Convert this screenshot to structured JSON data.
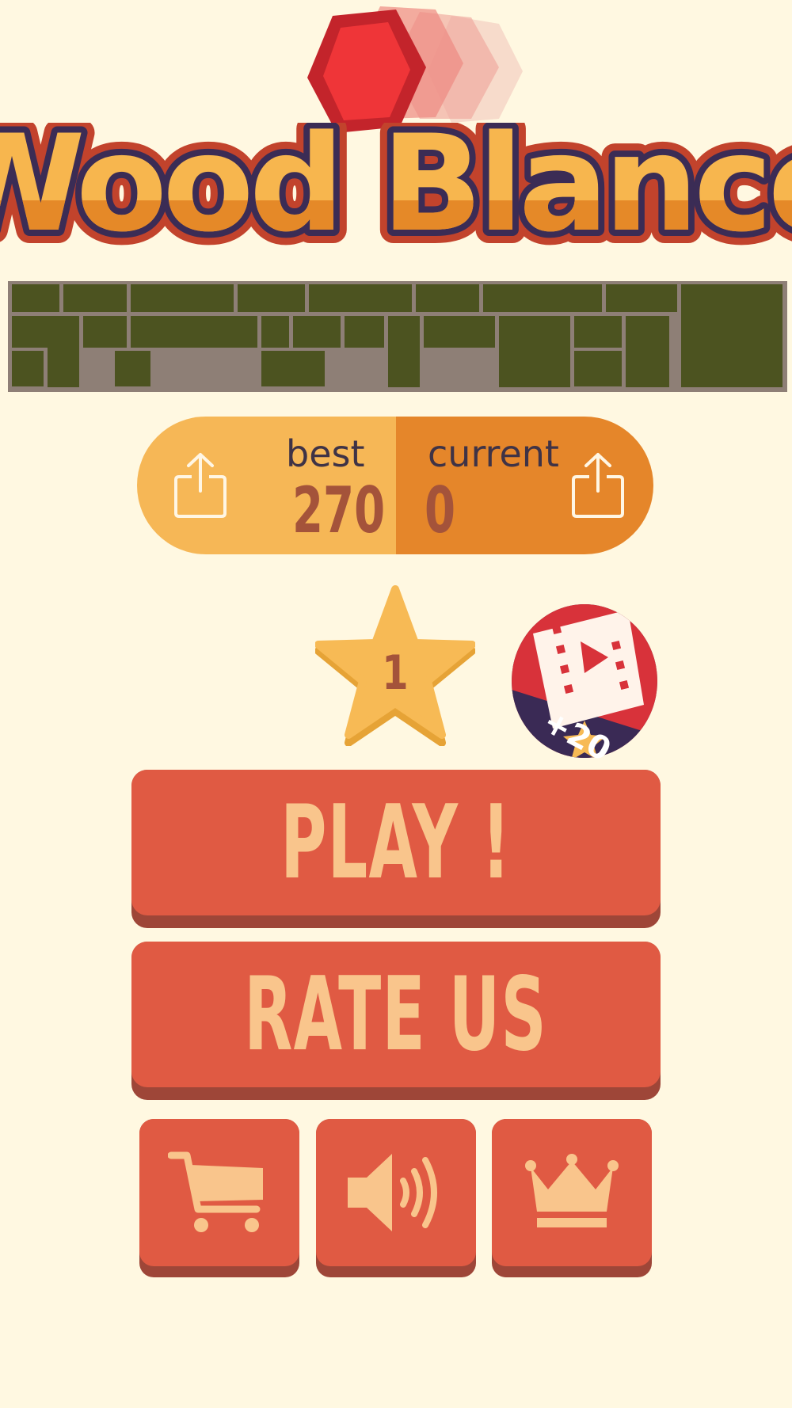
{
  "logo": {
    "title": "Wood Blance"
  },
  "scores": {
    "best_label": "best",
    "best_value": "270",
    "current_label": "current",
    "current_value": "0"
  },
  "stars": {
    "count": "1"
  },
  "video_reward": {
    "amount": "+20"
  },
  "buttons": {
    "play": "PLAY !",
    "rate": "RATE US"
  },
  "icons": {
    "share": "share-icon",
    "shop": "cart-icon",
    "sound": "speaker-icon",
    "leaderboard": "crown-icon"
  },
  "colors": {
    "background": "#fff8e1",
    "button": "#e05a43",
    "button_text": "#f9c58c",
    "best_panel": "#f6b756",
    "current_panel": "#e5862a",
    "score_text": "#a4533a",
    "block": "#4c5320"
  }
}
